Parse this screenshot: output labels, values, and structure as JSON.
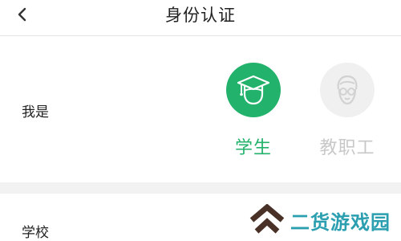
{
  "header": {
    "title": "身份认证"
  },
  "role": {
    "label": "我是",
    "options": [
      {
        "label": "学生",
        "icon": "graduation-cap-icon",
        "selected": true,
        "color": "#22b26b"
      },
      {
        "label": "教职工",
        "icon": "teacher-avatar-icon",
        "selected": false,
        "color": "#c8c8c8"
      }
    ]
  },
  "school": {
    "label": "学校"
  },
  "watermark": {
    "text": "二货游戏园"
  }
}
